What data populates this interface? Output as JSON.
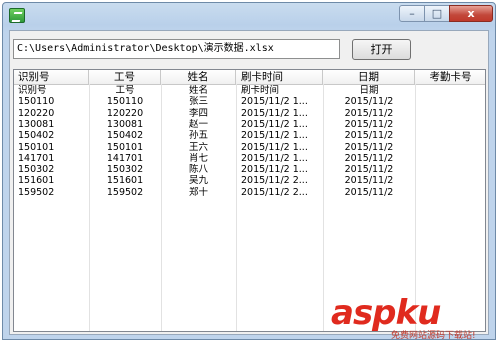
{
  "window": {
    "controls": {
      "minimize": "–",
      "maximize": "□",
      "close": "x"
    }
  },
  "path_input": {
    "value": "C:\\Users\\Administrator\\Desktop\\演示数据.xlsx"
  },
  "open_button": {
    "label": "打开"
  },
  "table": {
    "columns": [
      "识别号",
      "工号",
      "姓名",
      "刷卡时间",
      "日期",
      "考勤卡号"
    ],
    "rows": [
      [
        "识别号",
        "工号",
        "姓名",
        "刷卡时间",
        "日期",
        ""
      ],
      [
        "150110",
        "150110",
        "张三",
        "2015/11/2 1...",
        "2015/11/2",
        ""
      ],
      [
        "120220",
        "120220",
        "李四",
        "2015/11/2 1...",
        "2015/11/2",
        ""
      ],
      [
        "130081",
        "130081",
        "赵一",
        "2015/11/2 1...",
        "2015/11/2",
        ""
      ],
      [
        "150402",
        "150402",
        "孙五",
        "2015/11/2 1...",
        "2015/11/2",
        ""
      ],
      [
        "150101",
        "150101",
        "王六",
        "2015/11/2 1...",
        "2015/11/2",
        ""
      ],
      [
        "141701",
        "141701",
        "肖七",
        "2015/11/2 1...",
        "2015/11/2",
        ""
      ],
      [
        "150302",
        "150302",
        "陈八",
        "2015/11/2 1...",
        "2015/11/2",
        ""
      ],
      [
        "151601",
        "151601",
        "吴九",
        "2015/11/2 2...",
        "2015/11/2",
        ""
      ],
      [
        "159502",
        "159502",
        "郑十",
        "2015/11/2 2...",
        "2015/11/2",
        ""
      ]
    ]
  },
  "watermark": {
    "brand": "aspku",
    "tld": ".com",
    "tagline": "免费网站源码下载站!"
  },
  "colors": {
    "accent": "#e02a1e",
    "title_bar": "#c9dcef"
  }
}
